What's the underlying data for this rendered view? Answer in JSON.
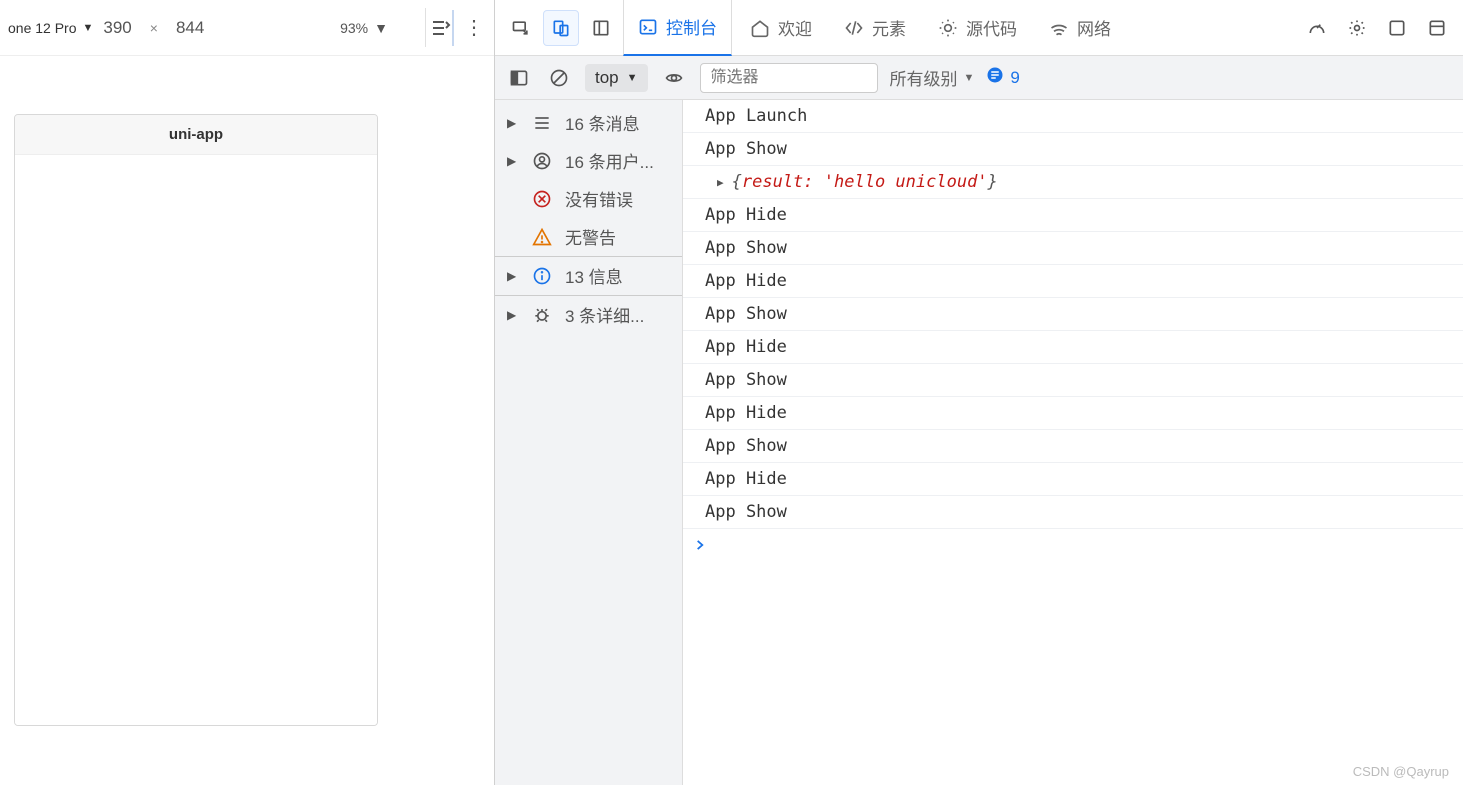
{
  "deviceBar": {
    "device": "one 12 Pro",
    "width": "390",
    "sep": "×",
    "height": "844",
    "zoom": "93%"
  },
  "phone": {
    "title": "uni-app"
  },
  "tabs": {
    "console": "控制台",
    "welcome": "欢迎",
    "elements": "元素",
    "sources": "源代码",
    "network": "网络"
  },
  "consoleTb": {
    "context": "top",
    "filterPlaceholder": "筛选器",
    "level": "所有级别",
    "issueCount": "9"
  },
  "side": {
    "messages": "16 条消息",
    "user": "16 条用户...",
    "noerr": "没有错误",
    "nowarn": "无警告",
    "info": "13 信息",
    "verbose": "3 条详细..."
  },
  "logs": [
    "App Launch",
    "App Show",
    "__OBJECT__",
    "App Hide",
    "App Show",
    "App Hide",
    "App Show",
    "App Hide",
    "App Show",
    "App Hide",
    "App Show",
    "App Hide",
    "App Show"
  ],
  "logObject": {
    "brace_open": "{",
    "key": "result:",
    "space": " ",
    "value": "'hello unicloud'",
    "brace_close": "}"
  },
  "watermark": "CSDN @Qayrup"
}
